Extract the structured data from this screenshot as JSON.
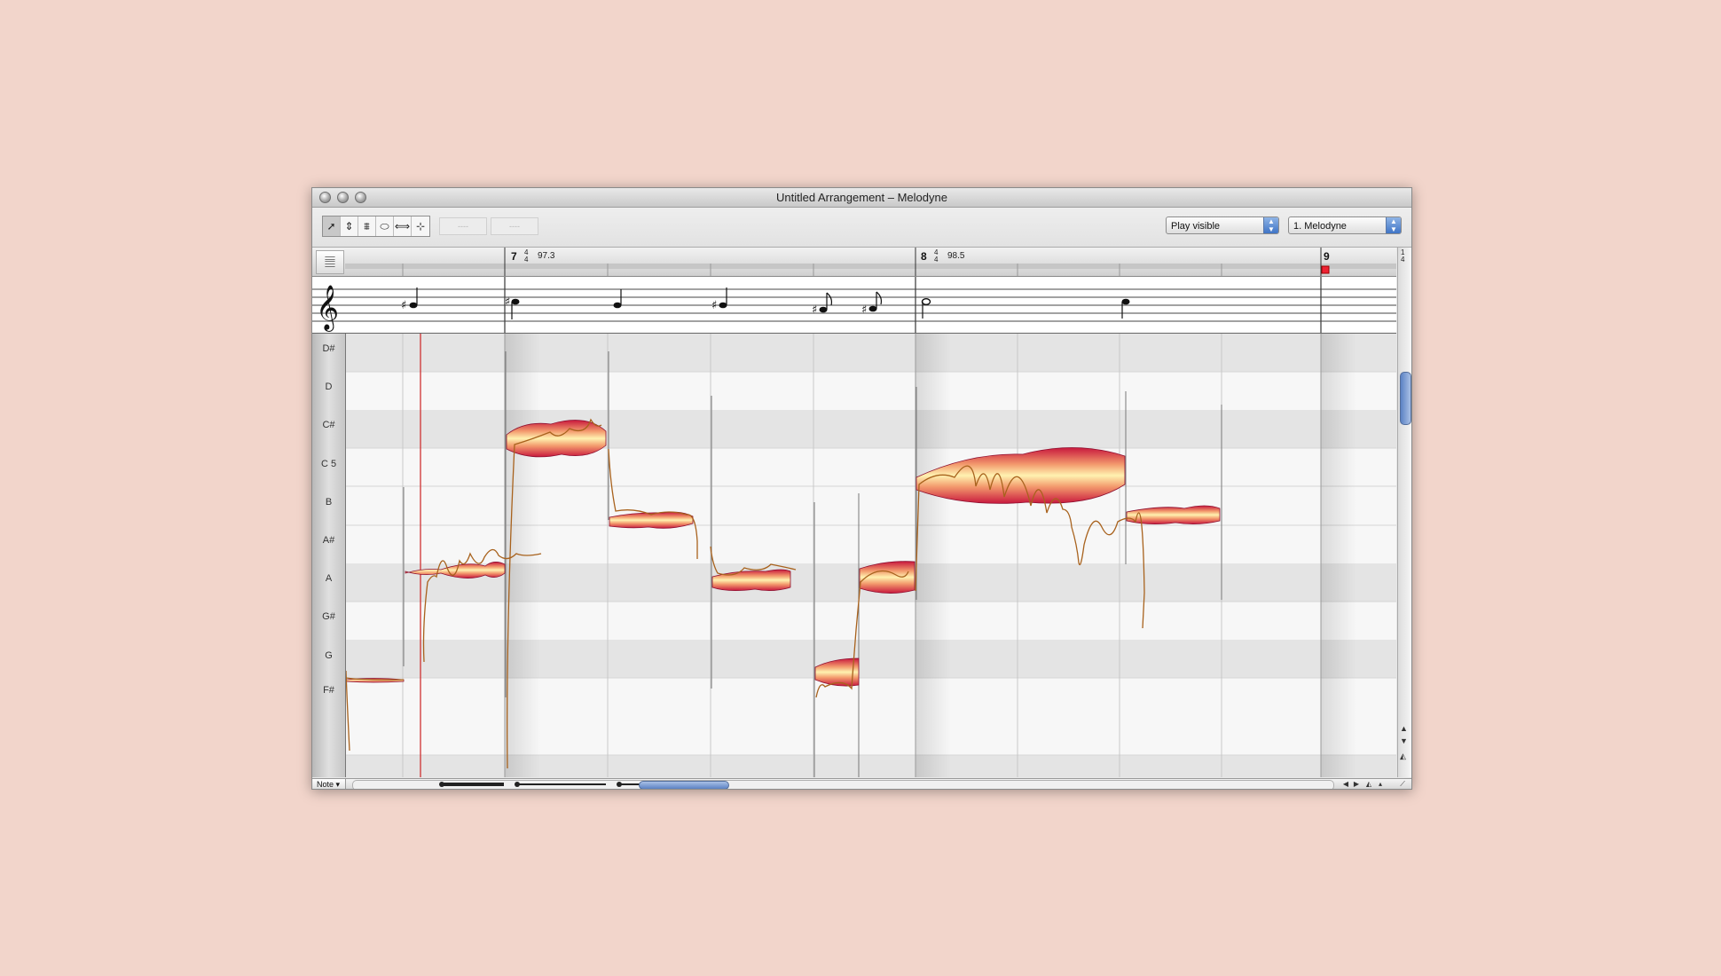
{
  "window": {
    "title": "Untitled Arrangement – Melodyne"
  },
  "toolbar": {
    "tools": [
      {
        "name": "main-tool",
        "glyph": "➚"
      },
      {
        "name": "pitch-tool",
        "glyph": "⇕"
      },
      {
        "name": "formant-tool",
        "glyph": "⩩"
      },
      {
        "name": "amplitude-tool",
        "glyph": "⬭"
      },
      {
        "name": "time-tool",
        "glyph": "⟺"
      },
      {
        "name": "note-separation-tool",
        "glyph": "⊹"
      }
    ],
    "ghost_1": "----",
    "ghost_2": "----",
    "playback_mode": "Play visible",
    "instance": "1. Melodyne"
  },
  "ruler": {
    "bars": [
      {
        "label": "7",
        "ts_top": "4",
        "ts_bottom": "4",
        "tempo": "97.3"
      },
      {
        "label": "8",
        "ts_top": "4",
        "ts_bottom": "4",
        "tempo": "98.5"
      },
      {
        "label": "9"
      }
    ],
    "corner_ts_top": "1",
    "corner_ts_bottom": "4"
  },
  "keyboard": {
    "keys": [
      "D#",
      "D",
      "C#",
      "C 5",
      "B",
      "A#",
      "A",
      "G#",
      "G",
      "F#"
    ]
  },
  "bottom": {
    "mode_button": "Note ▾"
  },
  "colors": {
    "blob_outer": "#c8183d",
    "blob_inner": "#fff2b0",
    "pitch_line": "#a8621d",
    "cursor": "#cc2222"
  }
}
